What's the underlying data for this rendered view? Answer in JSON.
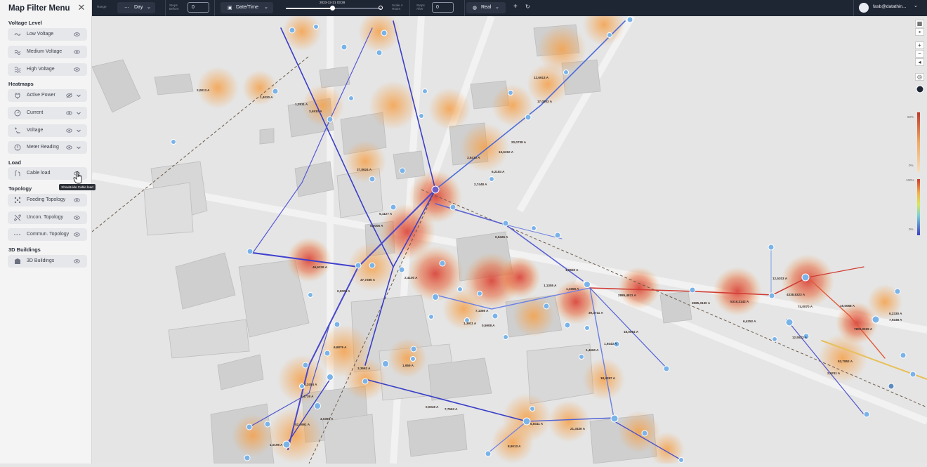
{
  "sidebar": {
    "title": "Map Filter Menu",
    "sections": {
      "voltage_level": "Voltage Level",
      "heatmaps": "Heatmaps",
      "load": "Load",
      "topology": "Topology",
      "buildings": "3D Buildings"
    },
    "items": {
      "low_voltage": "Low Voltage",
      "medium_voltage": "Medium Voltage",
      "high_voltage": "High Voltage",
      "active_power": "Active Power",
      "current": "Current",
      "voltage": "Voltage",
      "meter_reading": "Meter Reading",
      "cable_load": "Cable load",
      "feeding_topology": "Feeding Topology",
      "uncon_topology": "Uncon. Topology",
      "commun_topology": "Commun. Topology",
      "buildings_3d": "3D Buildings"
    },
    "tooltip": "Show/Hide Cable load"
  },
  "topbar": {
    "range_label": "Range",
    "range_value": "Day",
    "steps_before_label_1": "Steps",
    "steps_before_label_2": "Before",
    "steps_before_value": "0",
    "datetime_label": "Date/Time",
    "timestamp": "2023-12-21 03:28",
    "scale_label_1": "Scale 4",
    "scale_label_2": "Hours",
    "steps_after_label_1": "Steps",
    "steps_after_label_2": "After",
    "steps_after_value": "0",
    "mode_value": "Real",
    "user": "fasb@datathin..."
  },
  "legend": {
    "top_high": "60%",
    "top_low": "0%",
    "bottom_high": "100%",
    "bottom_low": "0%"
  },
  "map_labels": [
    "1,4020 A",
    "2,0813 A",
    "1,2811 A",
    "3,4910 A",
    "12,6613 A",
    "17,0803 A",
    "20,0738 A",
    "13,6310 A",
    "6,2184 A",
    "2,7448 A",
    "3,6410 A",
    "37,8624 A",
    "5,1127 A",
    "5,0006 A",
    "0,5426 A",
    "46,6239 A",
    "37,7285 A",
    "0,0008 A",
    "2,4100 A",
    "1,0550 A",
    "1,3911 A",
    "0,5908 A",
    "7,1366 A",
    "1,1355 A",
    "1,1959 A",
    "39,3711 A",
    "2885,4811 A",
    "3585,3130 A",
    "5316,3142 A",
    "4338,8323 A",
    "74,0070 A",
    "16,0058 A",
    "7800,0029 A",
    "53,7852 A",
    "6,2330 A",
    "7,9238 A",
    "2,6211 A",
    "6,4252 A",
    "12,5523 A",
    "12,5203 A",
    "18,0054 A",
    "1,4660 A",
    "1,9443 A",
    "18,4297 A",
    "21,3436 A",
    "8,9013 A",
    "5,8411 A",
    "7,7663 A",
    "0,0049 A",
    "6,6876 A",
    "4,3454 A",
    "2,4739 A",
    "52,0991 A",
    "3,0391 A",
    "1,0195 A",
    "3,3662 A",
    "1,959 A"
  ]
}
